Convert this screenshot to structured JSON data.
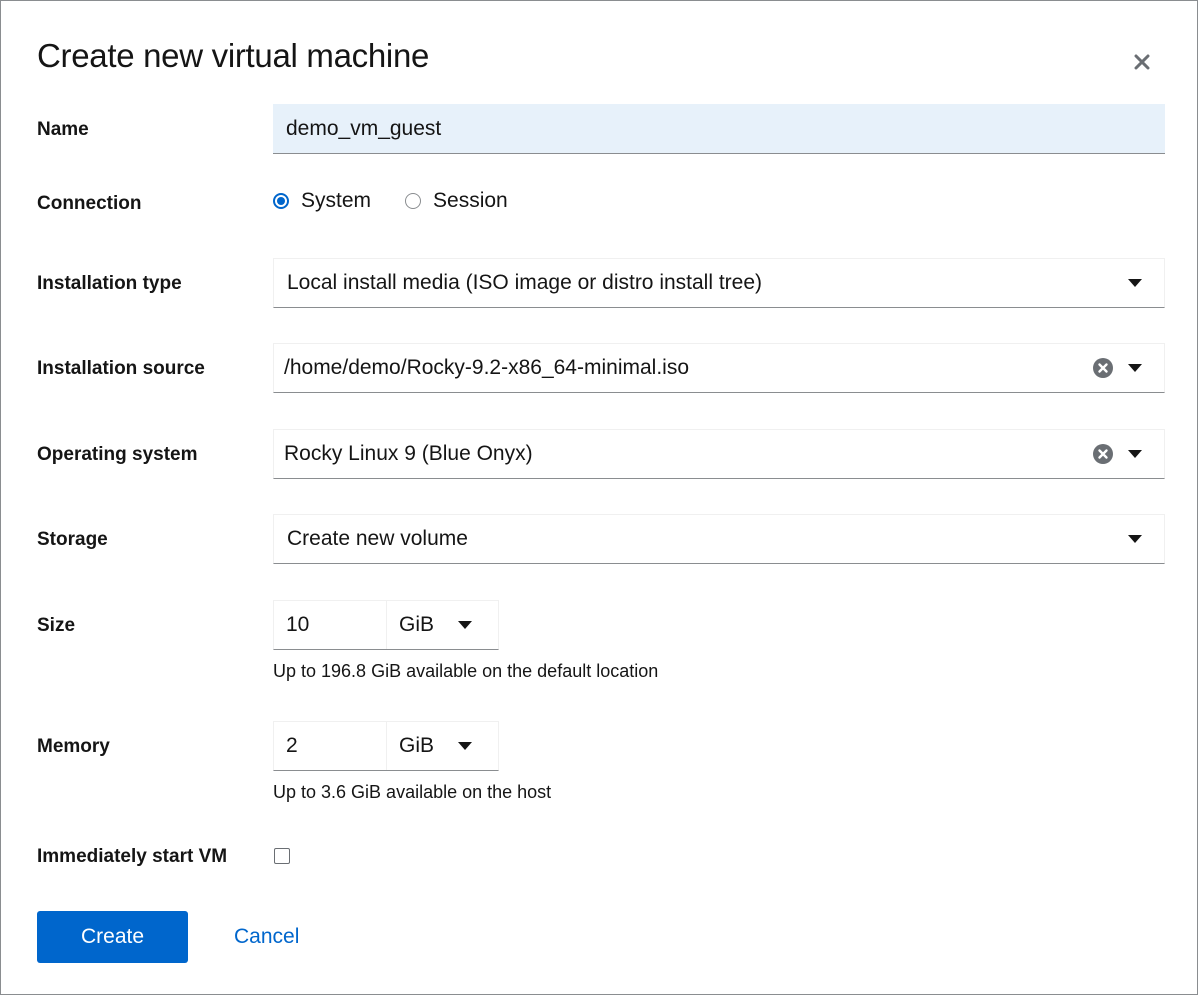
{
  "dialog": {
    "title": "Create new virtual machine"
  },
  "form": {
    "name": {
      "label": "Name",
      "value": "demo_vm_guest"
    },
    "connection": {
      "label": "Connection",
      "options": [
        {
          "label": "System",
          "checked": true
        },
        {
          "label": "Session",
          "checked": false
        }
      ]
    },
    "installation_type": {
      "label": "Installation type",
      "value": "Local install media (ISO image or distro install tree)"
    },
    "installation_source": {
      "label": "Installation source",
      "value": "/home/demo/Rocky-9.2-x86_64-minimal.iso"
    },
    "operating_system": {
      "label": "Operating system",
      "value": "Rocky Linux 9 (Blue Onyx)"
    },
    "storage": {
      "label": "Storage",
      "value": "Create new volume"
    },
    "size": {
      "label": "Size",
      "value": "10",
      "unit": "GiB",
      "helper": "Up to 196.8 GiB available on the default location"
    },
    "memory": {
      "label": "Memory",
      "value": "2",
      "unit": "GiB",
      "helper": "Up to 3.6 GiB available on the host"
    },
    "start_vm": {
      "label": "Immediately start VM",
      "checked": false
    }
  },
  "footer": {
    "create_label": "Create",
    "cancel_label": "Cancel"
  },
  "icons": {
    "close": "close-icon",
    "dropdown": "caret-down-icon",
    "clear": "clear-circle-icon"
  },
  "colors": {
    "primary": "#0066cc",
    "name_field_bg": "#e7f1fa",
    "border": "#8a8d90"
  }
}
